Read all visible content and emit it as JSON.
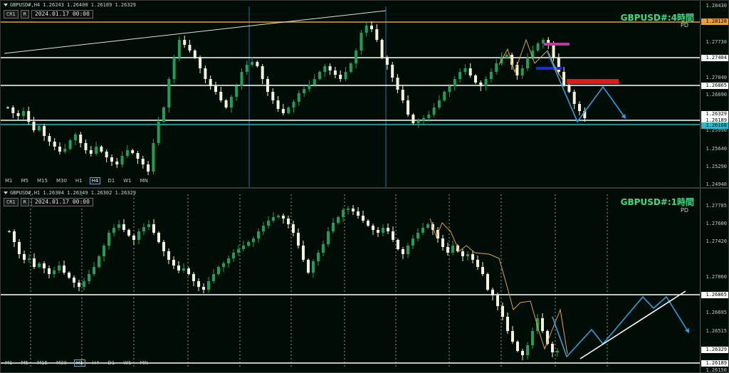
{
  "top_chart": {
    "header": "GBPUSD#,H4  1.26243 1.26400 1.26189 1.26329",
    "btn_cr": "CR1",
    "btn_r": "R",
    "date": "2024.01.17 00:00",
    "title": "GBPUSD#:4時間",
    "pd": "PD",
    "timeframes": [
      "M1",
      "M5",
      "M15",
      "M30",
      "H1",
      "H4",
      "D1",
      "W1",
      "MN"
    ],
    "active_timeframe": "H4",
    "axis_labels": [
      "1.28430",
      "1.27730",
      "1.27404",
      "1.27040",
      "1.26865",
      "1.26690",
      "1.26329",
      "1.26189",
      "1.26168",
      "1.25990",
      "1.25640",
      "1.25290",
      "1.24940"
    ],
    "tag_colors": {
      "orange": "#e6a23c",
      "white": "#ffffff",
      "teal": "#2fb8c4"
    },
    "tags": [
      {
        "label": "1.28128",
        "color": "#e6a23c"
      },
      {
        "label": "1.27404",
        "color": "#ffffff"
      },
      {
        "label": "1.26865",
        "color": "#ffffff"
      },
      {
        "label": "1.26329",
        "color": "#ffffff"
      },
      {
        "label": "1.26189",
        "color": "#ffffff"
      },
      {
        "label": "1.26168",
        "color": "#2fb8c4"
      }
    ]
  },
  "bottom_chart": {
    "header": "GBPUSD#,H1  1.26304 1.26349 1.26302 1.26329",
    "btn_cr": "CR1",
    "btn_r": "R",
    "date": "2024.01.17 00:00",
    "title": "GBPUSD#:1時間",
    "pd": "PD",
    "timeframes": [
      "M1",
      "M5",
      "M15",
      "M30",
      "H1",
      "H4",
      "D1",
      "W1",
      "MN"
    ],
    "active_timeframe": "H1",
    "axis_labels": [
      "1.27785",
      "1.27600",
      "1.27420",
      "1.27060",
      "1.26865",
      "1.26695",
      "1.26515",
      "1.26329",
      "1.26189",
      "1.26150"
    ],
    "tags": [
      {
        "label": "1.26865",
        "color": "#ffffff"
      },
      {
        "label": "1.26329",
        "color": "#ffffff"
      },
      {
        "label": "1.26189",
        "color": "#ffffff"
      }
    ]
  },
  "colors": {
    "bull_candle": "#1f9e5a",
    "bear_candle": "#f5f5dc",
    "title_green": "#3ddc84",
    "arrow_blue": "#2f9fe0",
    "level_orange": "#e6a23c",
    "magenta_zone": "#c03a9a",
    "blue_zone": "#1a2fd0",
    "red_zone": "#e01b1b"
  }
}
